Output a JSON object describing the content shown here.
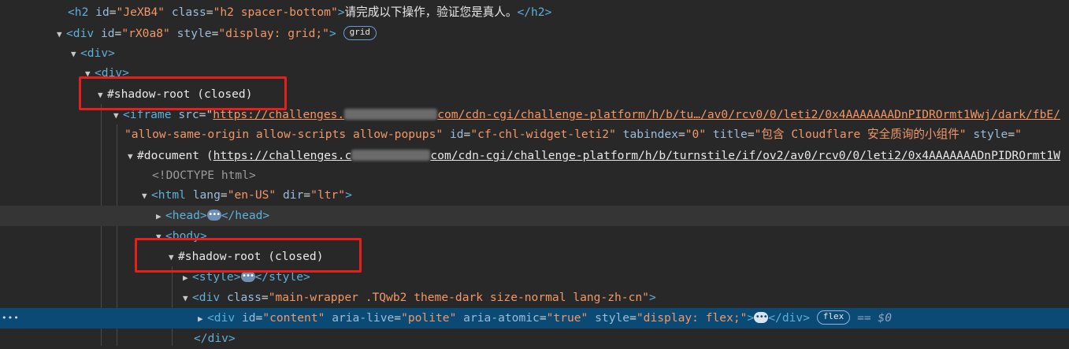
{
  "rows": {
    "h2": {
      "tag_open": "<h2",
      "id_attr": "id",
      "id_val": "\"JeXB4\"",
      "class_attr": "class",
      "class_val": "\"h2 spacer-bottom\"",
      "tag_close": ">",
      "text": "请完成以下操作，验证您是真人。",
      "end_tag": "</h2>"
    },
    "div_grid": {
      "toggle": "▼",
      "tag_open": "<div",
      "id_attr": "id",
      "id_val": "\"rX0a8\"",
      "style_attr": "style",
      "style_val": "\"display: grid;\"",
      "tag_close": ">",
      "badge": "grid"
    },
    "div1": {
      "toggle": "▼",
      "tag": "<div>"
    },
    "div2": {
      "toggle": "▼",
      "tag": "<div>"
    },
    "shadow1": {
      "toggle": "▼",
      "label": "#shadow-root (closed)"
    },
    "iframe": {
      "toggle": "▼",
      "tag_open": "<iframe",
      "src_attr": "src",
      "eq_q": "=\"",
      "url_a": "https://challenges.",
      "url_b": "com/cdn-cgi/challenge-platform/h/b/tu…/av0/rcv0/0/leti2/0x4AAAAAAADnPIDROrmt1Wwj/dark/fbE/"
    },
    "iframe2": {
      "sandbox_val": "\"allow-same-origin allow-scripts allow-popups\"",
      "id_attr": "id",
      "id_val": "\"cf-chl-widget-leti2\"",
      "tabindex_attr": "tabindex",
      "tabindex_val": "\"0\"",
      "title_attr": "title",
      "title_val": "\"包含 Cloudflare 安全质询的小组件\"",
      "style_attr": "style",
      "style_val": "\""
    },
    "document": {
      "toggle": "▼",
      "label": "#document (",
      "url_a": "https://challenges.c",
      "url_b": "com/cdn-cgi/challenge-platform/h/b/turnstile/if/ov2/av0/rcv0/0/leti2/0x4AAAAAAADnPIDROrmt1W"
    },
    "doctype": {
      "text": "<!DOCTYPE html>"
    },
    "html": {
      "toggle": "▼",
      "tag_open": "<html",
      "lang_attr": "lang",
      "lang_val": "\"en-US\"",
      "dir_attr": "dir",
      "dir_val": "\"ltr\"",
      "tag_close": ">"
    },
    "head": {
      "toggle": "▶",
      "tag": "<head>",
      "dots": "•••",
      "end_tag": "</head>"
    },
    "body": {
      "toggle": "▼",
      "tag": "<body>"
    },
    "shadow2": {
      "toggle": "▼",
      "label": "#shadow-root (closed)"
    },
    "style": {
      "toggle": "▶",
      "tag": "<style>",
      "dots": "•••",
      "end_tag": "</style>"
    },
    "wrapper": {
      "toggle": "▼",
      "tag_open": "<div",
      "class_attr": "class",
      "class_val": "\"main-wrapper .TQwb2 theme-dark size-normal lang-zh-cn\"",
      "tag_close": ">"
    },
    "content": {
      "gutter": "•••",
      "toggle": "▶",
      "tag_open": "<div",
      "id_attr": "id",
      "id_val": "\"content\"",
      "live_attr": "aria-live",
      "live_val": "\"polite\"",
      "atomic_attr": "aria-atomic",
      "atomic_val": "\"true\"",
      "style_attr": "style",
      "style_val": "\"display: flex;\"",
      "tag_close": ">",
      "dots": "•••",
      "end_tag": "</div>",
      "badge": "flex",
      "dollar": "== $0"
    },
    "div_close": {
      "tag": "</div>"
    }
  },
  "colors": {
    "background": "#282828",
    "selected_row": "#0b4a74",
    "tag": "#5db0d7",
    "attr_name": "#9bbbdc",
    "attr_value": "#f29766",
    "highlight_box": "#e5201c"
  }
}
